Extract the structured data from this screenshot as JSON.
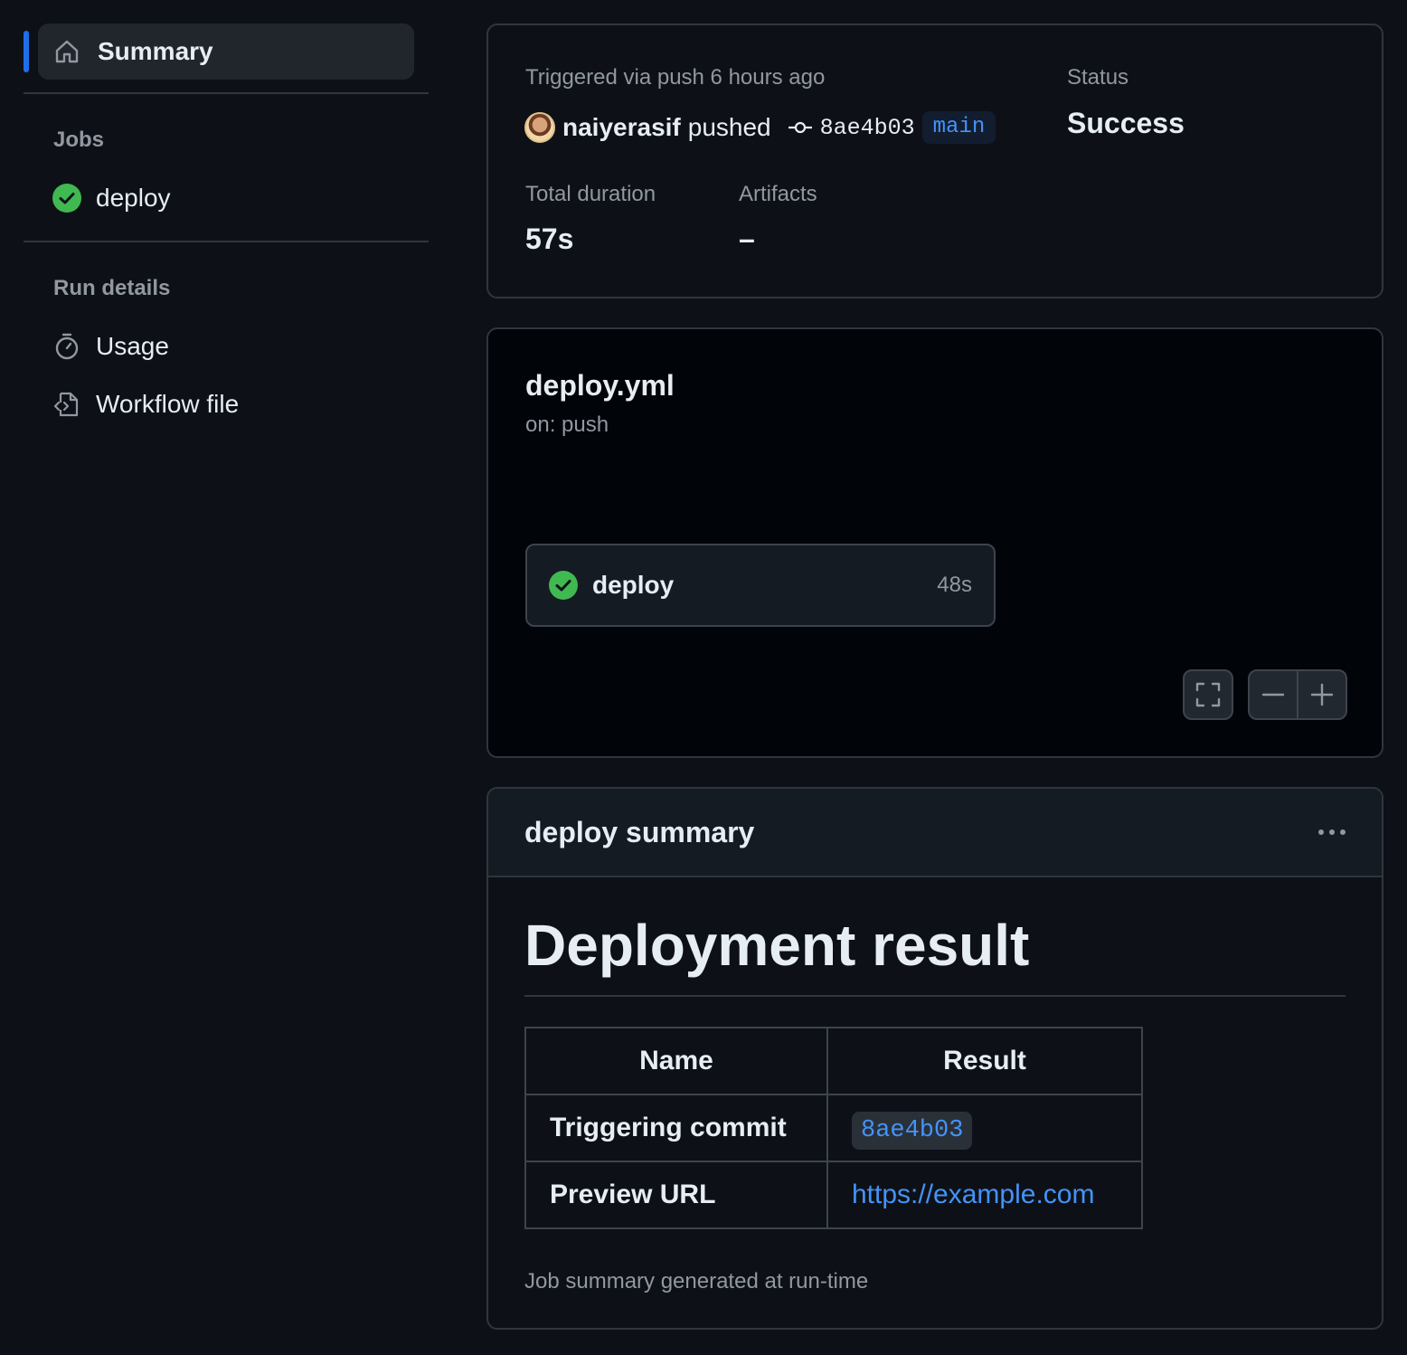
{
  "sidebar": {
    "summary_label": "Summary",
    "jobs_heading": "Jobs",
    "jobs": [
      {
        "label": "deploy",
        "status": "success"
      }
    ],
    "run_details_heading": "Run details",
    "usage_label": "Usage",
    "workflow_file_label": "Workflow file"
  },
  "run": {
    "trigger_text": "Triggered via push 6 hours ago",
    "pusher": "naiyerasif",
    "pushed_text": "pushed",
    "commit_sha": "8ae4b03",
    "branch": "main",
    "status_label": "Status",
    "status_value": "Success",
    "duration_label": "Total duration",
    "duration_value": "57s",
    "artifacts_label": "Artifacts",
    "artifacts_value": "–"
  },
  "workflow": {
    "file_name": "deploy.yml",
    "trigger": "on: push",
    "job": {
      "name": "deploy",
      "duration": "48s",
      "status": "success"
    }
  },
  "job_summary": {
    "header": "deploy summary",
    "heading": "Deployment result",
    "table": {
      "columns": [
        "Name",
        "Result"
      ],
      "rows": [
        {
          "name": "Triggering commit",
          "result": "8ae4b03"
        },
        {
          "name": "Preview URL",
          "result": "https://example.com"
        }
      ]
    },
    "footnote": "Job summary generated at run-time"
  },
  "colors": {
    "background": "#0d1117",
    "accent": "#1f6feb",
    "link": "#4493f8",
    "success": "#3fb950"
  }
}
